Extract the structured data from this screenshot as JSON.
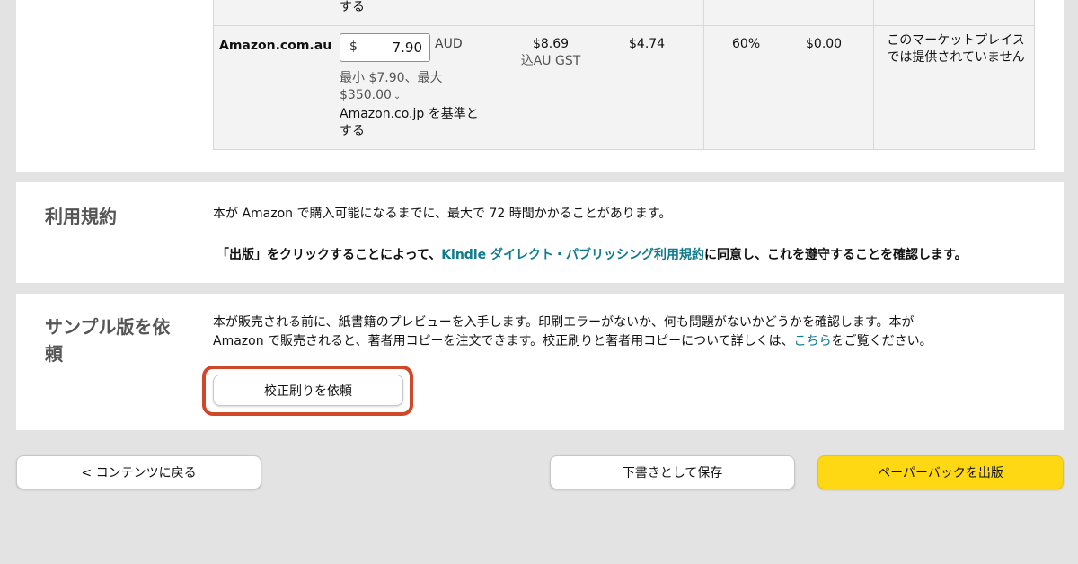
{
  "pricing": {
    "prev_row_tail": "する",
    "row": {
      "marketplace": "Amazon.com.au",
      "currency_symbol": "$",
      "price": "7.90",
      "currency": "AUD",
      "minmax_line1": "最小 $7.90、最大",
      "minmax_line2": "$350.00",
      "basis_line1": "Amazon.co.jp を基準と",
      "basis_line2": "する",
      "list_price": "$8.69",
      "list_price_tax": "込AU GST",
      "royalty_value": "$4.74",
      "royalty_rate": "60%",
      "delivery": "$0.00",
      "not_available": "このマーケットプレイスでは提供されていません"
    }
  },
  "terms": {
    "title": "利用規約",
    "line1": "本が Amazon で購入可能になるまでに、最大で 72 時間かかることがあります。",
    "line2_prefix": "「出版」をクリックすることによって、",
    "line2_link": "Kindle ダイレクト・パブリッシング利用規約",
    "line2_suffix": "に同意し、これを遵守することを確認します。"
  },
  "proof": {
    "title_line1": "サンプル版を依",
    "title_line2": "頼",
    "desc_line1": "本が販売される前に、紙書籍のプレビューを入手します。印刷エラーがないか、何も問題がないかどうかを確認します。本が",
    "desc_line2_prefix": "Amazon で販売されると、著者用コピーを注文できます。校正刷りと著者用コピーについて詳しくは、",
    "desc_link": "こちら",
    "desc_line2_suffix": "をご覧ください。",
    "button_label": "校正刷りを依頼"
  },
  "footer": {
    "back_label": "< コンテンツに戻る",
    "draft_label": "下書きとして保存",
    "publish_label": "ペーパーバックを出版"
  },
  "colors": {
    "link": "#0f7b8c",
    "publish_button": "#ffd814",
    "highlight": "#d0482a"
  },
  "icons": {
    "minmax_expand": "chevron-down-icon"
  }
}
